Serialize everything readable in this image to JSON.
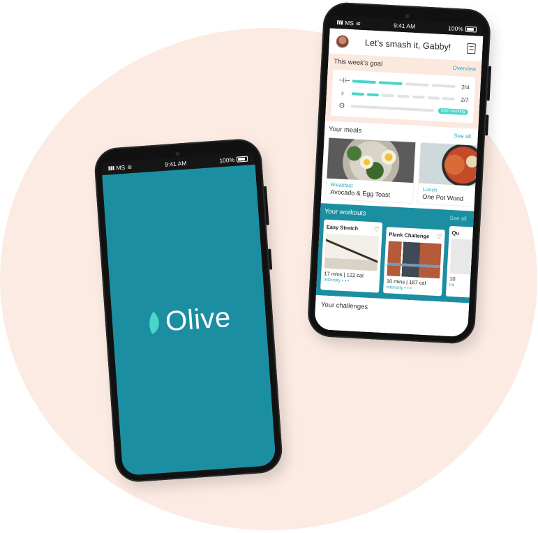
{
  "status_bar": {
    "carrier": "MS",
    "time": "9:41 AM",
    "battery": "100%"
  },
  "splash": {
    "app_name": "Olive"
  },
  "dashboard": {
    "greeting": "Let’s smash it, Gabby!",
    "weekly_goal": {
      "title": "This week’s goal",
      "link": "Overview",
      "rows": [
        {
          "icon": "dumbbell-icon",
          "count": "2/4",
          "progress": 0.5
        },
        {
          "icon": "apple-icon",
          "count": "2/7",
          "progress": 0.2857
        },
        {
          "icon": "footsteps-icon",
          "button": "Start tracking"
        }
      ]
    },
    "meals": {
      "title": "Your meals",
      "link": "See all",
      "items": [
        {
          "type": "Breakfast",
          "name": "Avocado & Egg Toast"
        },
        {
          "type": "Lunch",
          "name": "One Pot Wond"
        }
      ]
    },
    "workouts": {
      "title": "Your workouts",
      "link": "See all",
      "items": [
        {
          "title": "Easy Stretch",
          "mins": "17 mins",
          "cal": "122 cal",
          "intensity": "Intensity"
        },
        {
          "title": "Plank Challenge",
          "mins": "10 mins",
          "cal": "187 cal",
          "intensity": "Intensity"
        },
        {
          "title": "Qu",
          "mins": "10",
          "cal": "",
          "intensity": "Int"
        }
      ]
    },
    "challenges": {
      "title": "Your challenges"
    }
  },
  "colors": {
    "accent": "#49d6c9",
    "teal": "#1c8ea2",
    "peach": "#fcebe3"
  }
}
